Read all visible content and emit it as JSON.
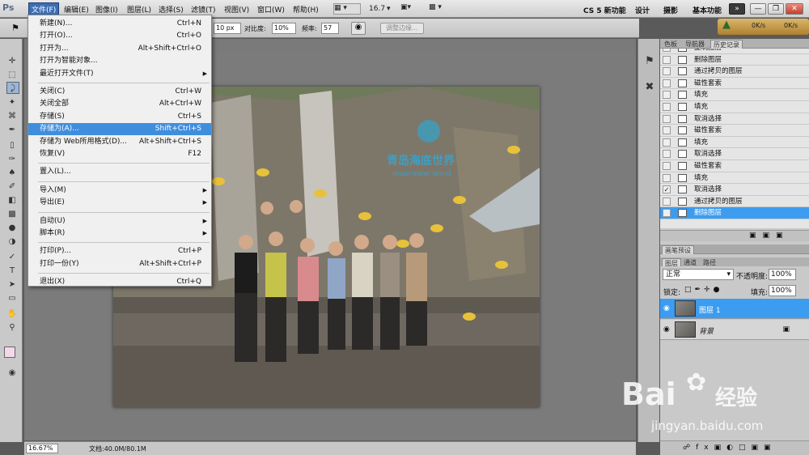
{
  "app": {
    "logo": "Ps"
  },
  "menubar": {
    "items": [
      "文件(F)",
      "编辑(E)",
      "图像(I)",
      "图层(L)",
      "选择(S)",
      "滤镜(T)",
      "视图(V)",
      "窗口(W)",
      "帮助(H)"
    ],
    "zoom": "16.7",
    "workspaces": [
      "CS 5 新功能",
      "设计",
      "摄影",
      "基本功能"
    ],
    "expand": "»"
  },
  "options": {
    "width_value": "10 px",
    "contrast_label": "对比度:",
    "contrast_value": "10%",
    "freq_label": "频率:",
    "freq_value": "57",
    "refine_edge": "调整边缘..."
  },
  "speed": {
    "down": "0K/s",
    "up": "0K/s"
  },
  "file_menu": {
    "groups": [
      [
        {
          "label": "新建(N)...",
          "shortcut": "Ctrl+N"
        },
        {
          "label": "打开(O)...",
          "shortcut": "Ctrl+O"
        },
        {
          "label": "打开为...",
          "shortcut": "Alt+Shift+Ctrl+O"
        },
        {
          "label": "打开为智能对象...",
          "shortcut": ""
        },
        {
          "label": "最近打开文件(T)",
          "shortcut": "",
          "submenu": true
        }
      ],
      [
        {
          "label": "关闭(C)",
          "shortcut": "Ctrl+W"
        },
        {
          "label": "关闭全部",
          "shortcut": "Alt+Ctrl+W"
        },
        {
          "label": "存储(S)",
          "shortcut": "Ctrl+S"
        },
        {
          "label": "存储为(A)...",
          "shortcut": "Shift+Ctrl+S",
          "highlighted": true
        },
        {
          "label": "存储为 Web所用格式(D)...",
          "shortcut": "Alt+Shift+Ctrl+S"
        },
        {
          "label": "恢复(V)",
          "shortcut": "F12"
        }
      ],
      [
        {
          "label": "置入(L)...",
          "shortcut": ""
        }
      ],
      [
        {
          "label": "导入(M)",
          "shortcut": "",
          "submenu": true
        },
        {
          "label": "导出(E)",
          "shortcut": "",
          "submenu": true
        }
      ],
      [
        {
          "label": "自动(U)",
          "shortcut": "",
          "submenu": true
        },
        {
          "label": "脚本(R)",
          "shortcut": "",
          "submenu": true
        }
      ],
      [
        {
          "label": "打印(P)...",
          "shortcut": "Ctrl+P"
        },
        {
          "label": "打印一份(Y)",
          "shortcut": "Alt+Shift+Ctrl+P"
        }
      ],
      [
        {
          "label": "退出(X)",
          "shortcut": "Ctrl+Q"
        }
      ]
    ]
  },
  "panels": {
    "top_tabs": [
      "色板",
      "导航器",
      "历史记录"
    ],
    "history": [
      "复制图层",
      "删除图层",
      "通过拷贝的图层",
      "磁性套索",
      "填充",
      "填充",
      "取消选择",
      "磁性套索",
      "填充",
      "取消选择",
      "磁性套索",
      "填充",
      "取消选择",
      "通过拷贝的图层",
      "删除图层"
    ],
    "brush_tab": "画笔预设",
    "layer_tabs": [
      "图层",
      "通道",
      "路径"
    ],
    "blend_mode": "正常",
    "opacity_label": "不透明度:",
    "opacity": "100%",
    "lock_label": "锁定:",
    "fill_label": "填充:",
    "fill": "100%",
    "layers": [
      {
        "name": "图层 1",
        "selected": true
      },
      {
        "name": "背景",
        "selected": false
      }
    ]
  },
  "photo": {
    "sign_text": "青岛海底世界",
    "sign_sub": "Underwater World"
  },
  "status": {
    "zoom": "16.67%",
    "doc": "文档:40.0M/80.1M"
  },
  "watermark": {
    "brand": "Bai",
    "brand2": "经验",
    "url": "jingyan.baidu.com"
  }
}
